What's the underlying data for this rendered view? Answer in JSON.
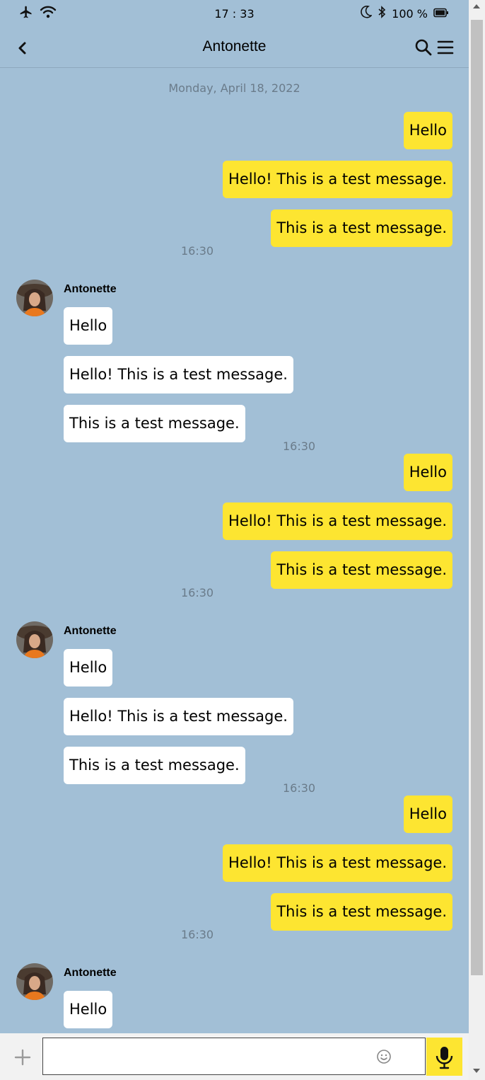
{
  "status_bar": {
    "time": "17 : 33",
    "battery": "100 %"
  },
  "header": {
    "title": "Antonette"
  },
  "chat": {
    "date": "Monday, April 18, 2022",
    "groups": [
      {
        "from": "me",
        "messages": [
          "Hello",
          "Hello! This is a test message.",
          "This is a test message."
        ],
        "time": "16:30"
      },
      {
        "from": "them",
        "sender": "Antonette",
        "messages": [
          "Hello",
          "Hello! This is a test message.",
          "This is a test message."
        ],
        "time": "16:30"
      },
      {
        "from": "me",
        "messages": [
          "Hello",
          "Hello! This is a test message.",
          "This is a test message."
        ],
        "time": "16:30"
      },
      {
        "from": "them",
        "sender": "Antonette",
        "messages": [
          "Hello",
          "Hello! This is a test message.",
          "This is a test message."
        ],
        "time": "16:30"
      },
      {
        "from": "me",
        "messages": [
          "Hello",
          "Hello! This is a test message.",
          "This is a test message."
        ],
        "time": "16:30"
      },
      {
        "from": "them",
        "sender": "Antonette",
        "messages": [
          "Hello"
        ]
      }
    ]
  },
  "input": {
    "value": "",
    "placeholder": ""
  },
  "colors": {
    "background": "#a2bfd6",
    "my_bubble": "#fde531",
    "their_bubble": "#ffffff",
    "timestamp": "#6a7b8a"
  },
  "icons": [
    "airplane-icon",
    "wifi-icon",
    "moon-icon",
    "bluetooth-icon",
    "battery-icon",
    "back-icon",
    "search-icon",
    "menu-icon",
    "plus-icon",
    "emoji-icon",
    "mic-icon"
  ]
}
